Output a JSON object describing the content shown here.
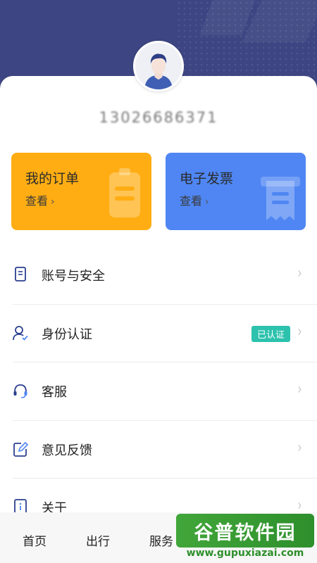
{
  "profile": {
    "phone": "13026686371"
  },
  "tiles": [
    {
      "title": "我的订单",
      "sub": "查看",
      "icon": "clipboard-icon"
    },
    {
      "title": "电子发票",
      "sub": "查看",
      "icon": "receipt-icon"
    }
  ],
  "menu": [
    {
      "label": "账号与安全",
      "icon": "document-icon"
    },
    {
      "label": "身份认证",
      "icon": "user-check-icon",
      "badge": "已认证"
    },
    {
      "label": "客服",
      "icon": "headset-icon"
    },
    {
      "label": "意见反馈",
      "icon": "edit-icon"
    },
    {
      "label": "关于",
      "icon": "info-icon"
    }
  ],
  "tabbar": {
    "tabs": [
      "首页",
      "出行",
      "服务"
    ]
  },
  "watermark": {
    "brand": "谷普软件园",
    "url": "www.gupuxiazai.com"
  },
  "colors": {
    "header": "#3d4682",
    "orders_tile": "#ffad13",
    "invoice_tile": "#4f86f3",
    "badge": "#2cc2ad",
    "watermark": "#41a63a"
  }
}
